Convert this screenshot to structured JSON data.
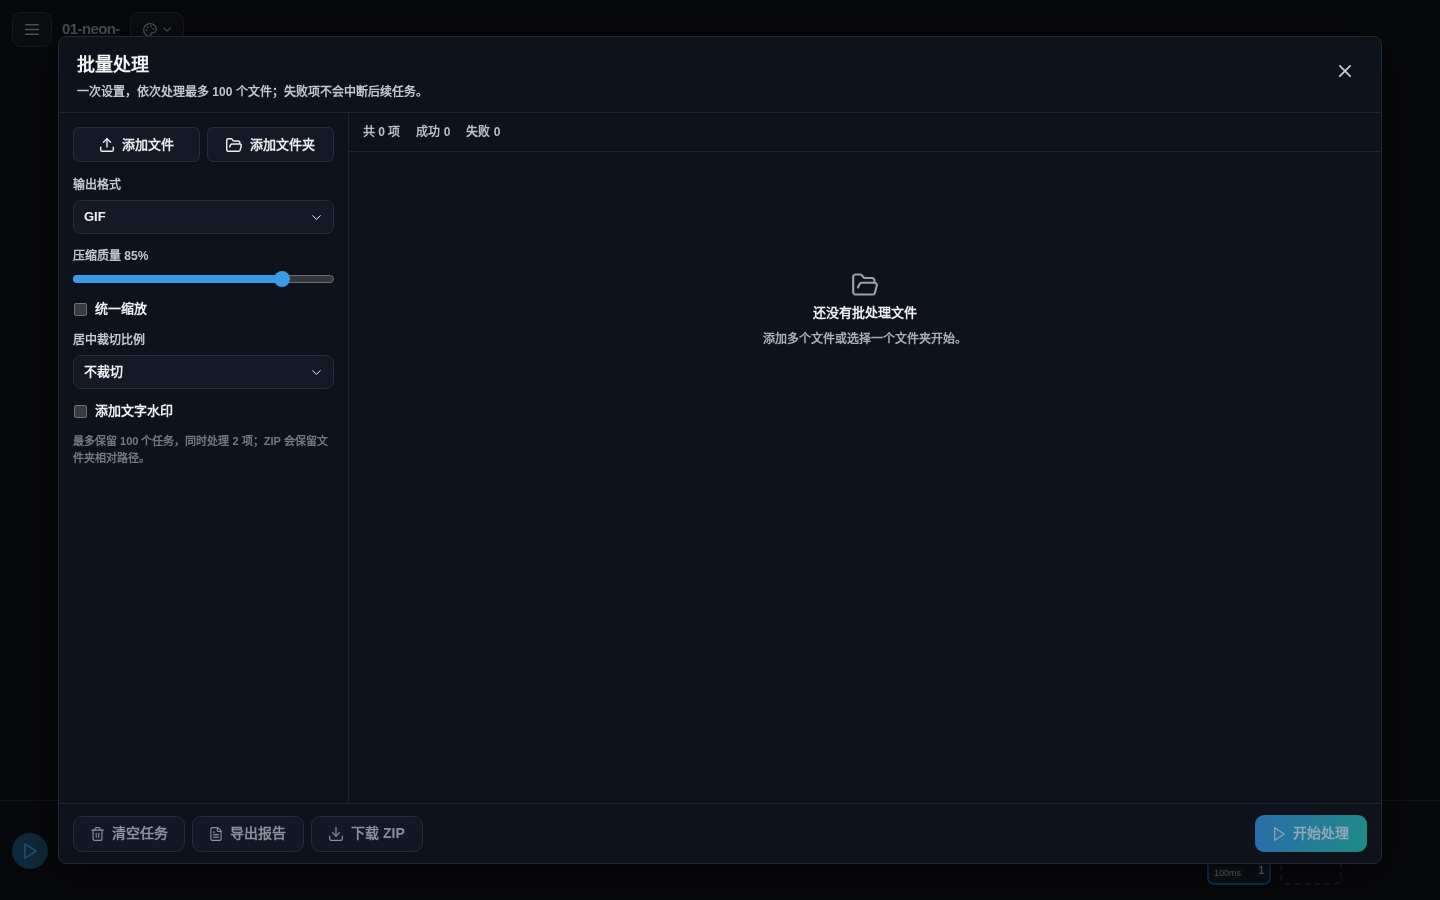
{
  "app": {
    "title": "01-neon-",
    "frames": [
      {
        "duration": "100ms",
        "number": "1"
      }
    ]
  },
  "dialog": {
    "title": "批量处理",
    "subtitle": "一次设置，依次处理最多 100 个文件；失败项不会中断后续任务。"
  },
  "sidebar": {
    "buttons": [
      {
        "label": "添加文件"
      },
      {
        "label": "添加文件夹"
      }
    ],
    "controls": [
      {
        "kind": "select",
        "label": "输出格式",
        "value": "GIF"
      },
      {
        "kind": "slider",
        "label": "压缩质量 85%",
        "level": 0.8
      },
      {
        "kind": "checkbox",
        "label": "统一缩放",
        "checked": false
      },
      {
        "kind": "select",
        "label": "居中裁切比例",
        "value": "不裁切"
      },
      {
        "kind": "checkbox",
        "label": "添加文字水印",
        "checked": false
      }
    ],
    "note": "最多保留 100 个任务，同时处理 2 项；ZIP 会保留文件夹相对路径。"
  },
  "stats": [
    "共 0 项",
    "成功 0",
    "失败 0"
  ],
  "empty_state": {
    "title": "还没有批处理文件",
    "text": "添加多个文件或选择一个文件夹开始。"
  },
  "footer": {
    "actions": [
      {
        "label": "清空任务",
        "disabled": true
      },
      {
        "label": "导出报告",
        "disabled": true
      },
      {
        "label": "下载 ZIP",
        "disabled": true
      }
    ],
    "primary": {
      "label": "开始处理",
      "disabled": true
    }
  }
}
